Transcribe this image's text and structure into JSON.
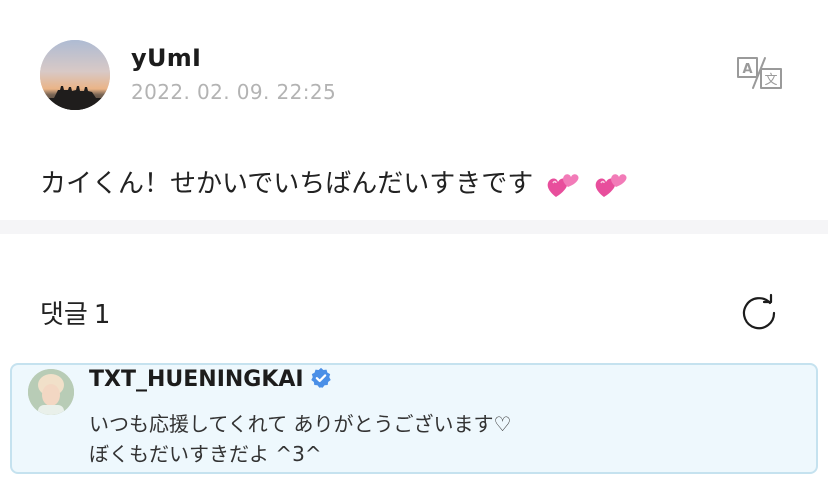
{
  "post": {
    "author": "yUmI",
    "timestamp": "2022. 02. 09. 22:25",
    "body": "カイくん！せかいでいちばんだいすきです",
    "emoji": [
      "revolving-hearts",
      "revolving-hearts"
    ]
  },
  "icons": {
    "translate": "translate-icon",
    "refresh": "refresh-icon",
    "verified": "verified-badge-icon"
  },
  "comments": {
    "label": "댓글",
    "count": "1",
    "items": [
      {
        "author": "TXT_HUENINGKAI",
        "verified": true,
        "lines": [
          "いつも応援してくれて ありがとうございます♡",
          "ぼくもだいすきだよ ^3^"
        ]
      }
    ]
  },
  "colors": {
    "highlight_bg": "#eef8fd",
    "highlight_border": "#c5e2ef",
    "verified_blue": "#4a8fe7",
    "heart_pink": "#e84e9c",
    "timestamp_gray": "#b3b3b3",
    "divider_gray": "#f5f5f7"
  }
}
